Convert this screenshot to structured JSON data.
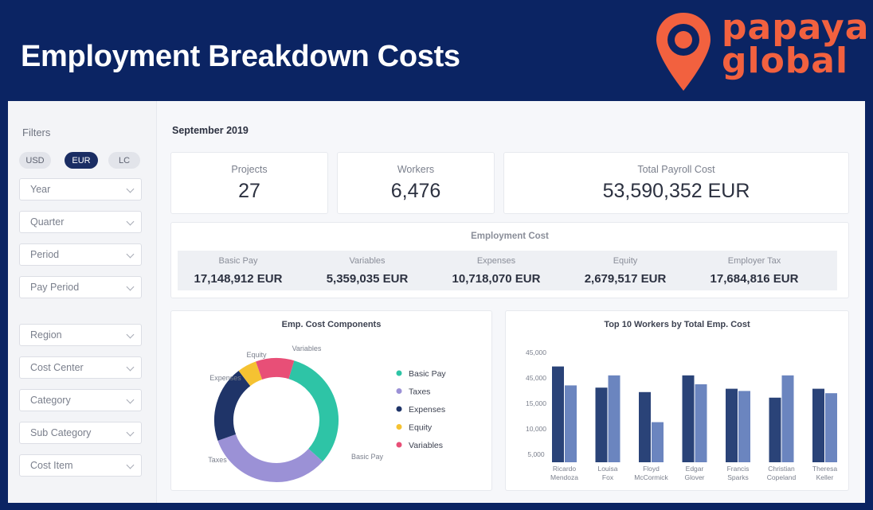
{
  "header": {
    "title": "Employment Breakdown Costs",
    "logo_text": "papaya global"
  },
  "sidebar": {
    "filters_label": "Filters",
    "currencies": [
      {
        "label": "USD",
        "active": false
      },
      {
        "label": "EUR",
        "active": true
      },
      {
        "label": "LC",
        "active": false
      }
    ],
    "group1": [
      "Year",
      "Quarter",
      "Period",
      "Pay Period"
    ],
    "group2": [
      "Region",
      "Cost Center",
      "Category",
      "Sub Category",
      "Cost Item"
    ]
  },
  "main": {
    "period": "September 2019",
    "kpis": [
      {
        "label": "Projects",
        "value": "27"
      },
      {
        "label": "Workers",
        "value": "6,476"
      },
      {
        "label": "Total Payroll Cost",
        "value": "53,590,352 EUR"
      }
    ],
    "employment_cost": {
      "title": "Employment Cost",
      "items": [
        {
          "label": "Basic Pay",
          "value": "17,148,912 EUR"
        },
        {
          "label": "Variables",
          "value": "5,359,035 EUR"
        },
        {
          "label": "Expenses",
          "value": "10,718,070 EUR"
        },
        {
          "label": "Equity",
          "value": "2,679,517 EUR"
        },
        {
          "label": "Employer Tax",
          "value": "17,684,816 EUR"
        }
      ]
    }
  },
  "chart_data": [
    {
      "type": "pie",
      "title": "Emp. Cost Components",
      "legend_placement": "right",
      "categories": [
        "Basic Pay",
        "Taxes",
        "Expenses",
        "Equity",
        "Variables"
      ],
      "values": [
        17148912,
        17684816,
        10718070,
        2679517,
        5359035
      ],
      "colors": [
        "#2ec4a6",
        "#9b91d6",
        "#1f3468",
        "#f5c232",
        "#e84f77"
      ]
    },
    {
      "type": "bar",
      "title": "Top 10 Workers by Total Emp. Cost",
      "categories": [
        {
          "line1": "Ricardo",
          "line2": "Mendoza"
        },
        {
          "line1": "Louisa",
          "line2": "Fox"
        },
        {
          "line1": "Floyd",
          "line2": "McCormick"
        },
        {
          "line1": "Edgar",
          "line2": "Glover"
        },
        {
          "line1": "Francis",
          "line2": "Sparks"
        },
        {
          "line1": "Christian",
          "line2": "Copeland"
        },
        {
          "line1": "Theresa",
          "line2": "Keller"
        }
      ],
      "yticks": [
        "45,000",
        "45,000",
        "15,000",
        "10,000",
        "5,000"
      ],
      "series": [
        {
          "values": [
            0.86,
            0.67,
            0.63,
            0.78,
            0.66,
            0.58,
            0.66
          ],
          "color": "#2a4378"
        },
        {
          "values": [
            0.69,
            0.78,
            0.36,
            0.7,
            0.64,
            0.78,
            0.62
          ],
          "color": "#6b85bf"
        }
      ],
      "note": "bar heights are read as fractions of the plotted axis span (tick labels on the original are inconsistent)"
    }
  ]
}
